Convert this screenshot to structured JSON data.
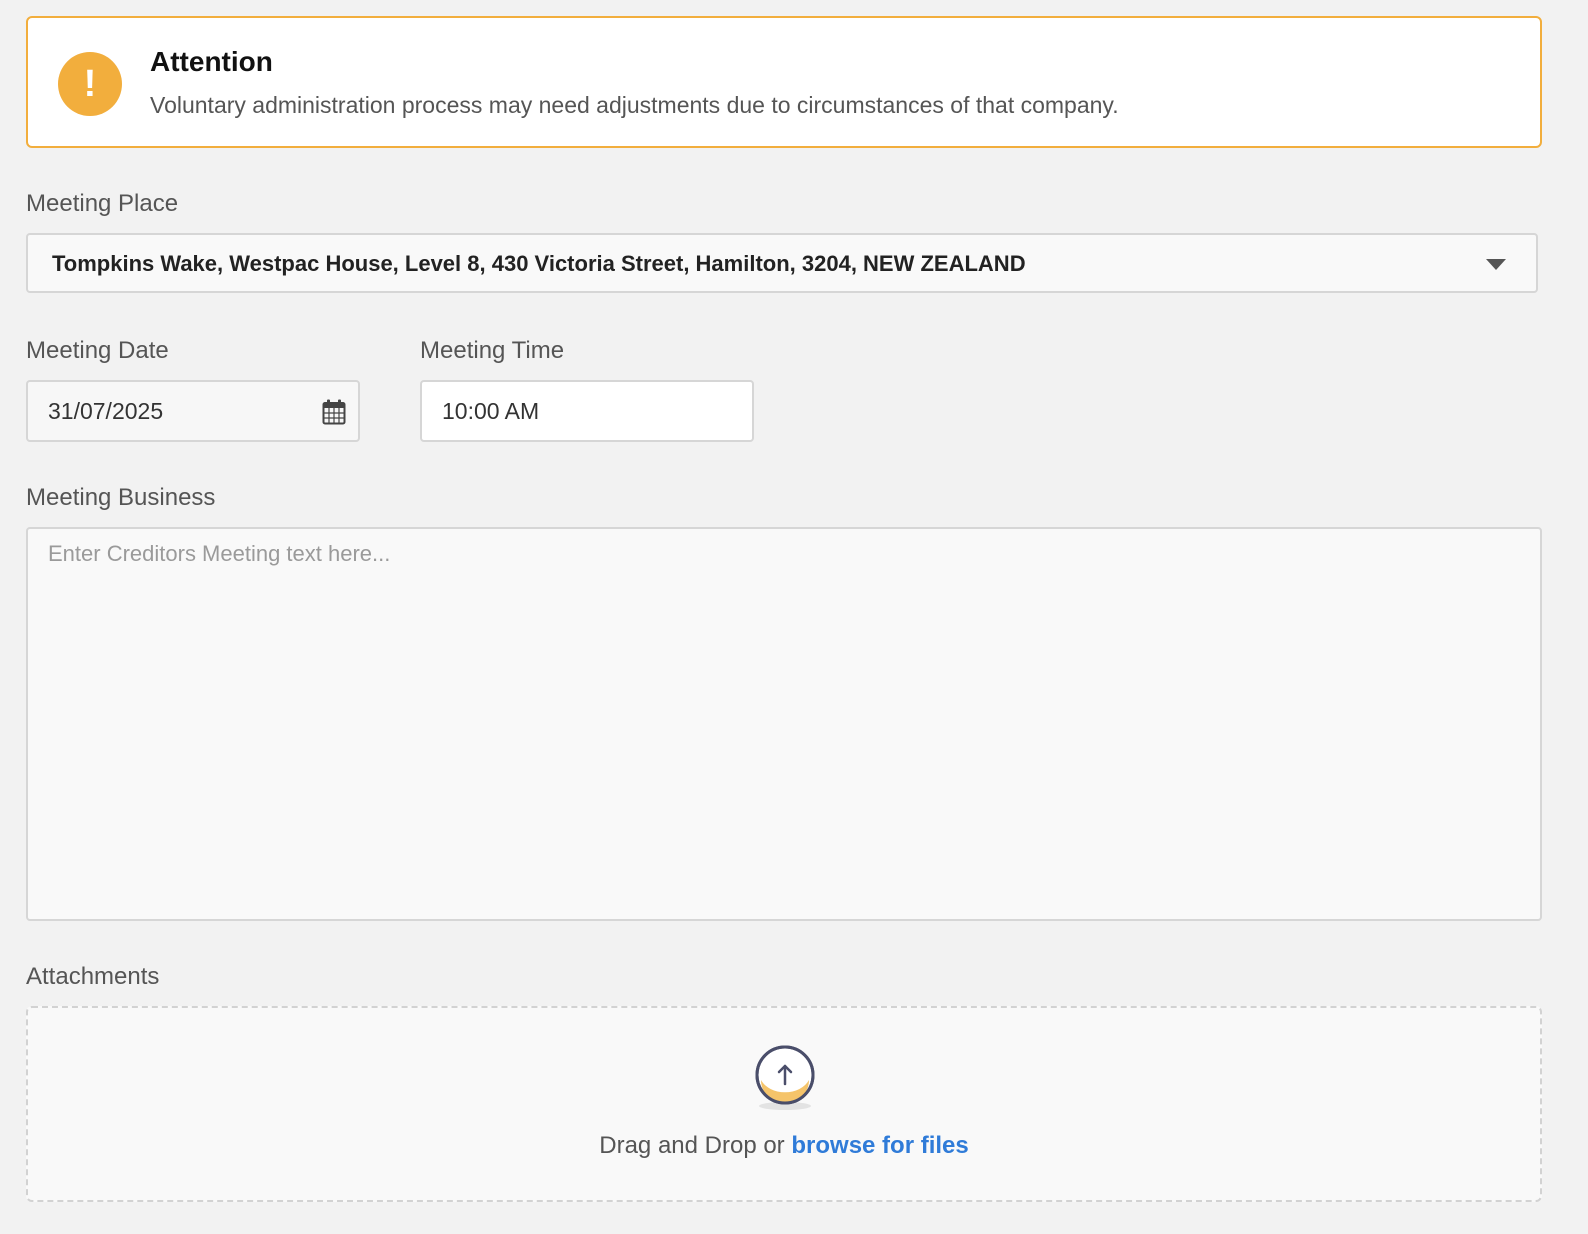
{
  "alert": {
    "title": "Attention",
    "message": "Voluntary administration process may need adjustments due to circumstances of that company.",
    "icon": "exclamation-icon",
    "color": "#f2ae3d"
  },
  "meeting_place": {
    "label": "Meeting Place",
    "selected": "Tompkins Wake, Westpac House, Level 8, 430 Victoria Street, Hamilton, 3204, NEW ZEALAND"
  },
  "meeting_date": {
    "label": "Meeting Date",
    "value": "31/07/2025",
    "icon": "calendar-icon"
  },
  "meeting_time": {
    "label": "Meeting Time",
    "value": "10:00 AM"
  },
  "meeting_business": {
    "label": "Meeting Business",
    "placeholder": "Enter Creditors Meeting text here..."
  },
  "attachments": {
    "label": "Attachments",
    "drop_text": "Drag and Drop or",
    "browse_link": "browse for files",
    "icon": "upload-icon",
    "link_color": "#2f7bd8"
  }
}
